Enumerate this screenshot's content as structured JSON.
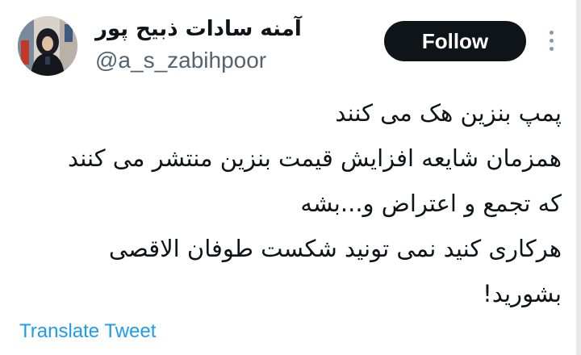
{
  "author": {
    "display_name": "آمنه سادات ذبیح پور",
    "handle": "@a_s_zabihpoor",
    "avatar_icon": "profile-photo"
  },
  "actions": {
    "follow_label": "Follow",
    "more_icon": "more-vertical-icon"
  },
  "tweet": {
    "lines": [
      "پمپ بنزین هک می کنند",
      "همزمان شایعه افزایش قیمت بنزین منتشر می کنند",
      "که تجمع و اعتراض و...بشه",
      "هرکاری کنید نمی تونید شکست طوفان الاقصی",
      "بشورید!"
    ]
  },
  "footer": {
    "translate_label": "Translate Tweet"
  },
  "colors": {
    "follow_bg": "#0f1419",
    "handle": "#536471",
    "link": "#1d9bf0"
  }
}
